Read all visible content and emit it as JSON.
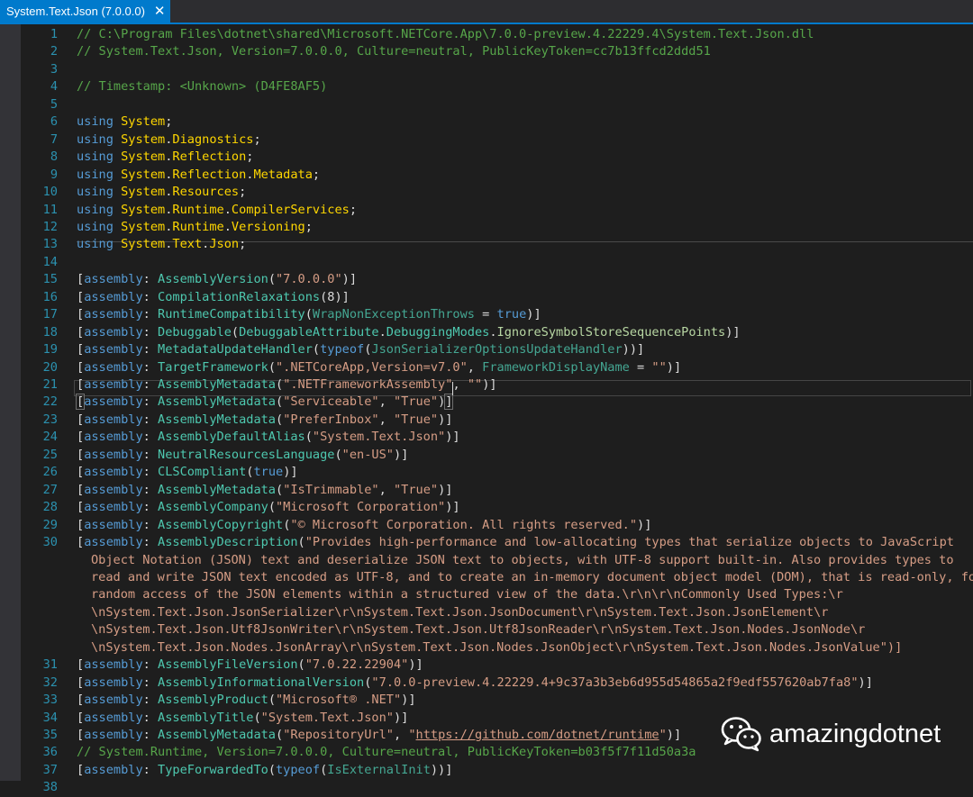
{
  "tab": {
    "title": "System.Text.Json (7.0.0.0)",
    "close_glyph": "✕"
  },
  "lines": [
    [
      {
        "k": "c",
        "t": "// C:\\Program Files\\dotnet\\shared\\Microsoft.NETCore.App\\7.0.0-preview.4.22229.4\\System.Text.Json.dll"
      }
    ],
    [
      {
        "k": "c",
        "t": "// System.Text.Json, Version=7.0.0.0, Culture=neutral, PublicKeyToken=cc7b13ffcd2ddd51"
      }
    ],
    [],
    [
      {
        "k": "c",
        "t": "// Timestamp: <Unknown> (D4FE8AF5)"
      }
    ],
    [],
    [
      {
        "k": "k",
        "t": "using"
      },
      {
        "k": "d",
        "t": " "
      },
      {
        "k": "ns",
        "t": "System"
      },
      {
        "k": "d",
        "t": ";"
      }
    ],
    [
      {
        "k": "k",
        "t": "using"
      },
      {
        "k": "d",
        "t": " "
      },
      {
        "k": "ns",
        "t": "System"
      },
      {
        "k": "d",
        "t": "."
      },
      {
        "k": "ns",
        "t": "Diagnostics"
      },
      {
        "k": "d",
        "t": ";"
      }
    ],
    [
      {
        "k": "k",
        "t": "using"
      },
      {
        "k": "d",
        "t": " "
      },
      {
        "k": "ns",
        "t": "System"
      },
      {
        "k": "d",
        "t": "."
      },
      {
        "k": "ns",
        "t": "Reflection"
      },
      {
        "k": "d",
        "t": ";"
      }
    ],
    [
      {
        "k": "k",
        "t": "using"
      },
      {
        "k": "d",
        "t": " "
      },
      {
        "k": "ns",
        "t": "System"
      },
      {
        "k": "d",
        "t": "."
      },
      {
        "k": "ns",
        "t": "Reflection"
      },
      {
        "k": "d",
        "t": "."
      },
      {
        "k": "ns",
        "t": "Metadata"
      },
      {
        "k": "d",
        "t": ";"
      }
    ],
    [
      {
        "k": "k",
        "t": "using"
      },
      {
        "k": "d",
        "t": " "
      },
      {
        "k": "ns",
        "t": "System"
      },
      {
        "k": "d",
        "t": "."
      },
      {
        "k": "ns",
        "t": "Resources"
      },
      {
        "k": "d",
        "t": ";"
      }
    ],
    [
      {
        "k": "k",
        "t": "using"
      },
      {
        "k": "d",
        "t": " "
      },
      {
        "k": "ns",
        "t": "System"
      },
      {
        "k": "d",
        "t": "."
      },
      {
        "k": "ns",
        "t": "Runtime"
      },
      {
        "k": "d",
        "t": "."
      },
      {
        "k": "ns",
        "t": "CompilerServices"
      },
      {
        "k": "d",
        "t": ";"
      }
    ],
    [
      {
        "k": "k",
        "t": "using"
      },
      {
        "k": "d",
        "t": " "
      },
      {
        "k": "ns",
        "t": "System"
      },
      {
        "k": "d",
        "t": "."
      },
      {
        "k": "ns",
        "t": "Runtime"
      },
      {
        "k": "d",
        "t": "."
      },
      {
        "k": "ns",
        "t": "Versioning"
      },
      {
        "k": "d",
        "t": ";"
      }
    ],
    [
      {
        "k": "k",
        "t": "using"
      },
      {
        "k": "d",
        "t": " "
      },
      {
        "k": "ns",
        "t": "System"
      },
      {
        "k": "d",
        "t": "."
      },
      {
        "k": "ns",
        "t": "Text"
      },
      {
        "k": "d",
        "t": "."
      },
      {
        "k": "ns",
        "t": "Json"
      },
      {
        "k": "d",
        "t": ";"
      }
    ],
    [],
    [
      {
        "k": "d",
        "t": "["
      },
      {
        "k": "k",
        "t": "assembly"
      },
      {
        "k": "d",
        "t": ": "
      },
      {
        "k": "t",
        "t": "AssemblyVersion"
      },
      {
        "k": "d",
        "t": "("
      },
      {
        "k": "s",
        "t": "\"7.0.0.0\""
      },
      {
        "k": "d",
        "t": ")]"
      }
    ],
    [
      {
        "k": "d",
        "t": "["
      },
      {
        "k": "k",
        "t": "assembly"
      },
      {
        "k": "d",
        "t": ": "
      },
      {
        "k": "t",
        "t": "CompilationRelaxations"
      },
      {
        "k": "d",
        "t": "(8)]"
      }
    ],
    [
      {
        "k": "d",
        "t": "["
      },
      {
        "k": "k",
        "t": "assembly"
      },
      {
        "k": "d",
        "t": ": "
      },
      {
        "k": "t",
        "t": "RuntimeCompatibility"
      },
      {
        "k": "d",
        "t": "("
      },
      {
        "k": "p",
        "t": "WrapNonExceptionThrows"
      },
      {
        "k": "d",
        "t": " = "
      },
      {
        "k": "k",
        "t": "true"
      },
      {
        "k": "d",
        "t": ")]"
      }
    ],
    [
      {
        "k": "d",
        "t": "["
      },
      {
        "k": "k",
        "t": "assembly"
      },
      {
        "k": "d",
        "t": ": "
      },
      {
        "k": "t",
        "t": "Debuggable"
      },
      {
        "k": "d",
        "t": "("
      },
      {
        "k": "t",
        "t": "DebuggableAttribute"
      },
      {
        "k": "d",
        "t": "."
      },
      {
        "k": "t",
        "t": "DebuggingModes"
      },
      {
        "k": "d",
        "t": "."
      },
      {
        "k": "em",
        "t": "IgnoreSymbolStoreSequencePoints"
      },
      {
        "k": "d",
        "t": ")]"
      }
    ],
    [
      {
        "k": "d",
        "t": "["
      },
      {
        "k": "k",
        "t": "assembly"
      },
      {
        "k": "d",
        "t": ": "
      },
      {
        "k": "t",
        "t": "MetadataUpdateHandler"
      },
      {
        "k": "d",
        "t": "("
      },
      {
        "k": "k",
        "t": "typeof"
      },
      {
        "k": "d",
        "t": "("
      },
      {
        "k": "p",
        "t": "JsonSerializerOptionsUpdateHandler"
      },
      {
        "k": "d",
        "t": "))]"
      }
    ],
    [
      {
        "k": "d",
        "t": "["
      },
      {
        "k": "k",
        "t": "assembly"
      },
      {
        "k": "d",
        "t": ": "
      },
      {
        "k": "t",
        "t": "TargetFramework"
      },
      {
        "k": "d",
        "t": "("
      },
      {
        "k": "s",
        "t": "\".NETCoreApp,Version=v7.0\""
      },
      {
        "k": "d",
        "t": ", "
      },
      {
        "k": "p",
        "t": "FrameworkDisplayName"
      },
      {
        "k": "d",
        "t": " = "
      },
      {
        "k": "s",
        "t": "\"\""
      },
      {
        "k": "d",
        "t": ")]"
      }
    ],
    [
      {
        "k": "d",
        "t": "["
      },
      {
        "k": "k",
        "t": "assembly"
      },
      {
        "k": "d",
        "t": ": "
      },
      {
        "k": "t",
        "t": "AssemblyMetadata"
      },
      {
        "k": "d",
        "t": "("
      },
      {
        "k": "s",
        "t": "\".NETFrameworkAssembly\""
      },
      {
        "k": "d",
        "t": ", "
      },
      {
        "k": "s",
        "t": "\"\""
      },
      {
        "k": "d",
        "t": ")]"
      }
    ],
    [
      {
        "k": "dh",
        "t": "["
      },
      {
        "k": "k",
        "t": "assembly"
      },
      {
        "k": "d",
        "t": ": "
      },
      {
        "k": "t",
        "t": "AssemblyMetadata"
      },
      {
        "k": "d",
        "t": "("
      },
      {
        "k": "s",
        "t": "\"Serviceable\""
      },
      {
        "k": "d",
        "t": ", "
      },
      {
        "k": "s",
        "t": "\"True\""
      },
      {
        "k": "d",
        "t": ")"
      },
      {
        "k": "dh",
        "t": "]"
      }
    ],
    [
      {
        "k": "d",
        "t": "["
      },
      {
        "k": "k",
        "t": "assembly"
      },
      {
        "k": "d",
        "t": ": "
      },
      {
        "k": "t",
        "t": "AssemblyMetadata"
      },
      {
        "k": "d",
        "t": "("
      },
      {
        "k": "s",
        "t": "\"PreferInbox\""
      },
      {
        "k": "d",
        "t": ", "
      },
      {
        "k": "s",
        "t": "\"True\""
      },
      {
        "k": "d",
        "t": ")]"
      }
    ],
    [
      {
        "k": "d",
        "t": "["
      },
      {
        "k": "k",
        "t": "assembly"
      },
      {
        "k": "d",
        "t": ": "
      },
      {
        "k": "t",
        "t": "AssemblyDefaultAlias"
      },
      {
        "k": "d",
        "t": "("
      },
      {
        "k": "s",
        "t": "\"System.Text.Json\""
      },
      {
        "k": "d",
        "t": ")]"
      }
    ],
    [
      {
        "k": "d",
        "t": "["
      },
      {
        "k": "k",
        "t": "assembly"
      },
      {
        "k": "d",
        "t": ": "
      },
      {
        "k": "t",
        "t": "NeutralResourcesLanguage"
      },
      {
        "k": "d",
        "t": "("
      },
      {
        "k": "s",
        "t": "\"en-US\""
      },
      {
        "k": "d",
        "t": ")]"
      }
    ],
    [
      {
        "k": "d",
        "t": "["
      },
      {
        "k": "k",
        "t": "assembly"
      },
      {
        "k": "d",
        "t": ": "
      },
      {
        "k": "t",
        "t": "CLSCompliant"
      },
      {
        "k": "d",
        "t": "("
      },
      {
        "k": "k",
        "t": "true"
      },
      {
        "k": "d",
        "t": ")]"
      }
    ],
    [
      {
        "k": "d",
        "t": "["
      },
      {
        "k": "k",
        "t": "assembly"
      },
      {
        "k": "d",
        "t": ": "
      },
      {
        "k": "t",
        "t": "AssemblyMetadata"
      },
      {
        "k": "d",
        "t": "("
      },
      {
        "k": "s",
        "t": "\"IsTrimmable\""
      },
      {
        "k": "d",
        "t": ", "
      },
      {
        "k": "s",
        "t": "\"True\""
      },
      {
        "k": "d",
        "t": ")]"
      }
    ],
    [
      {
        "k": "d",
        "t": "["
      },
      {
        "k": "k",
        "t": "assembly"
      },
      {
        "k": "d",
        "t": ": "
      },
      {
        "k": "t",
        "t": "AssemblyCompany"
      },
      {
        "k": "d",
        "t": "("
      },
      {
        "k": "s",
        "t": "\"Microsoft Corporation\""
      },
      {
        "k": "d",
        "t": ")]"
      }
    ],
    [
      {
        "k": "d",
        "t": "["
      },
      {
        "k": "k",
        "t": "assembly"
      },
      {
        "k": "d",
        "t": ": "
      },
      {
        "k": "t",
        "t": "AssemblyCopyright"
      },
      {
        "k": "d",
        "t": "("
      },
      {
        "k": "s",
        "t": "\"© Microsoft Corporation. All rights reserved.\""
      },
      {
        "k": "d",
        "t": ")]"
      }
    ],
    [
      {
        "k": "d",
        "t": "["
      },
      {
        "k": "k",
        "t": "assembly"
      },
      {
        "k": "d",
        "t": ": "
      },
      {
        "k": "t",
        "t": "AssemblyDescription"
      },
      {
        "k": "d",
        "t": "("
      },
      {
        "k": "s",
        "t": "\"Provides high-performance and low-allocating types that serialize objects to JavaScript"
      }
    ],
    [
      {
        "k": "s",
        "t": "Object Notation (JSON) text and deserialize JSON text to objects, with UTF-8 support built-in. Also provides types to"
      }
    ],
    [
      {
        "k": "s",
        "t": "read and write JSON text encoded as UTF-8, and to create an in-memory document object model (DOM), that is read-only, for"
      }
    ],
    [
      {
        "k": "s",
        "t": "random access of the JSON elements within a structured view of the data.\\r\\n\\r\\nCommonly Used Types:\\r"
      }
    ],
    [
      {
        "k": "s",
        "t": "\\nSystem.Text.Json.JsonSerializer\\r\\nSystem.Text.Json.JsonDocument\\r\\nSystem.Text.Json.JsonElement\\r"
      }
    ],
    [
      {
        "k": "s",
        "t": "\\nSystem.Text.Json.Utf8JsonWriter\\r\\nSystem.Text.Json.Utf8JsonReader\\r\\nSystem.Text.Json.Nodes.JsonNode\\r"
      }
    ],
    [
      {
        "k": "s",
        "t": "\\nSystem.Text.Json.Nodes.JsonArray\\r\\nSystem.Text.Json.Nodes.JsonObject\\r\\nSystem.Text.Json.Nodes.JsonValue\""
      },
      {
        "k": "d",
        "t": ")]"
      }
    ],
    [
      {
        "k": "d",
        "t": "["
      },
      {
        "k": "k",
        "t": "assembly"
      },
      {
        "k": "d",
        "t": ": "
      },
      {
        "k": "t",
        "t": "AssemblyFileVersion"
      },
      {
        "k": "d",
        "t": "("
      },
      {
        "k": "s",
        "t": "\"7.0.22.22904\""
      },
      {
        "k": "d",
        "t": ")]"
      }
    ],
    [
      {
        "k": "d",
        "t": "["
      },
      {
        "k": "k",
        "t": "assembly"
      },
      {
        "k": "d",
        "t": ": "
      },
      {
        "k": "t",
        "t": "AssemblyInformationalVersion"
      },
      {
        "k": "d",
        "t": "("
      },
      {
        "k": "s",
        "t": "\"7.0.0-preview.4.22229.4+9c37a3b3eb6d955d54865a2f9edf557620ab7fa8\""
      },
      {
        "k": "d",
        "t": ")]"
      }
    ],
    [
      {
        "k": "d",
        "t": "["
      },
      {
        "k": "k",
        "t": "assembly"
      },
      {
        "k": "d",
        "t": ": "
      },
      {
        "k": "t",
        "t": "AssemblyProduct"
      },
      {
        "k": "d",
        "t": "("
      },
      {
        "k": "s",
        "t": "\"Microsoft® .NET\""
      },
      {
        "k": "d",
        "t": ")]"
      }
    ],
    [
      {
        "k": "d",
        "t": "["
      },
      {
        "k": "k",
        "t": "assembly"
      },
      {
        "k": "d",
        "t": ": "
      },
      {
        "k": "t",
        "t": "AssemblyTitle"
      },
      {
        "k": "d",
        "t": "("
      },
      {
        "k": "s",
        "t": "\"System.Text.Json\""
      },
      {
        "k": "d",
        "t": ")]"
      }
    ],
    [
      {
        "k": "d",
        "t": "["
      },
      {
        "k": "k",
        "t": "assembly"
      },
      {
        "k": "d",
        "t": ": "
      },
      {
        "k": "t",
        "t": "AssemblyMetadata"
      },
      {
        "k": "d",
        "t": "("
      },
      {
        "k": "s",
        "t": "\"RepositoryUrl\""
      },
      {
        "k": "d",
        "t": ", "
      },
      {
        "k": "s",
        "t": "\""
      },
      {
        "k": "u",
        "t": "https://github.com/dotnet/runtime"
      },
      {
        "k": "s",
        "t": "\""
      },
      {
        "k": "d",
        "t": ")]"
      }
    ],
    [
      {
        "k": "c",
        "t": "// System.Runtime, Version=7.0.0.0, Culture=neutral, PublicKeyToken=b03f5f7f11d50a3a"
      }
    ],
    [
      {
        "k": "d",
        "t": "["
      },
      {
        "k": "k",
        "t": "assembly"
      },
      {
        "k": "d",
        "t": ": "
      },
      {
        "k": "t",
        "t": "TypeForwardedTo"
      },
      {
        "k": "d",
        "t": "("
      },
      {
        "k": "k",
        "t": "typeof"
      },
      {
        "k": "d",
        "t": "("
      },
      {
        "k": "p",
        "t": "IsExternalInit"
      },
      {
        "k": "d",
        "t": "))]"
      }
    ],
    []
  ],
  "line_numbers": [
    "1",
    "2",
    "",
    "4",
    "",
    "6",
    "7",
    "8",
    "9",
    "10",
    "11",
    "12",
    "13",
    "14",
    "15",
    "16",
    "17",
    "18",
    "19",
    "20",
    "21",
    "22",
    "23",
    "24",
    "25",
    "26",
    "27",
    "28",
    "29",
    "30",
    "",
    "",
    "",
    "",
    "",
    "",
    "31",
    "32",
    "33",
    "34",
    "35",
    "36",
    "37",
    "38"
  ],
  "empty_line_number_3": "3",
  "empty_line_number_5": "5",
  "watermark": {
    "text": "amazingdotnet",
    "icon": "wechat-icon"
  },
  "colors": {
    "editor_bg": "#1e1e1e",
    "tab_active": "#007acc",
    "comment": "#57a64a",
    "keyword": "#569cd6",
    "namespace": "#ffd700",
    "type": "#4ec9b0",
    "string": "#d69d85",
    "line_number": "#2b91af"
  }
}
